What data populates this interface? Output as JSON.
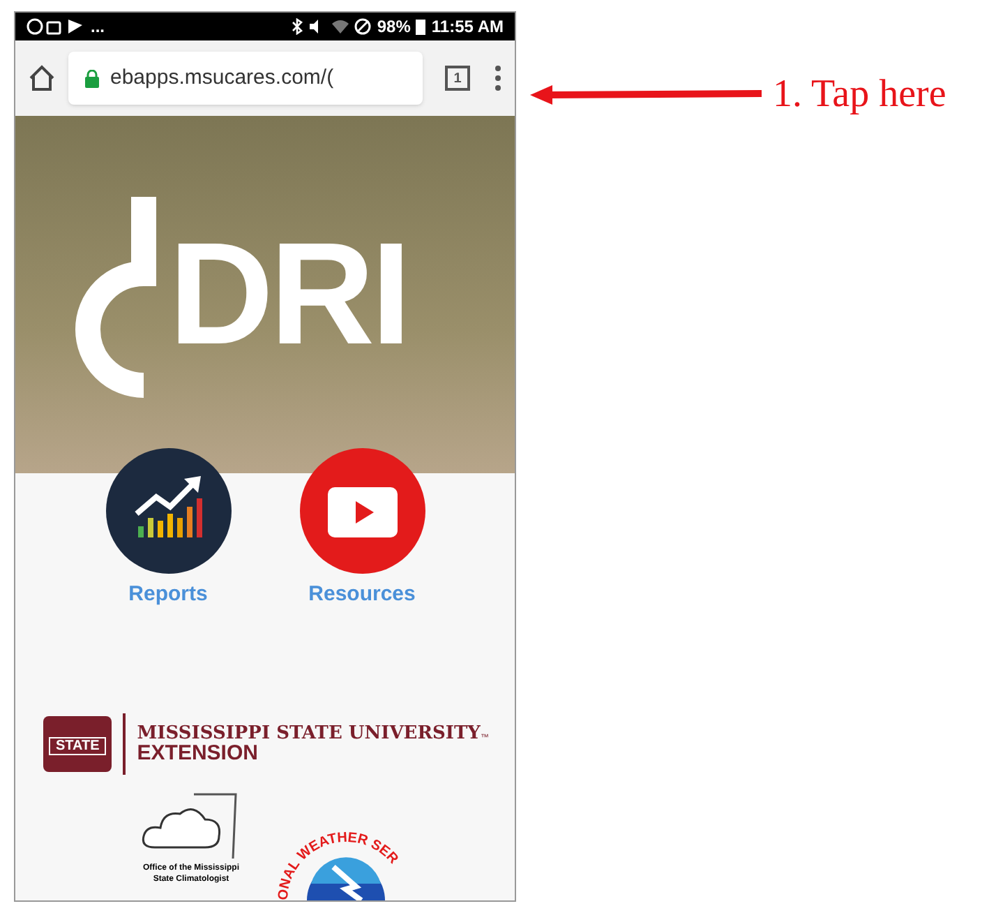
{
  "status_bar": {
    "left_more": "...",
    "battery": "98%",
    "time": "11:55 AM"
  },
  "browser": {
    "url": "ebapps.msucares.com/(",
    "tab_count": "1"
  },
  "hero": {
    "logo_text": "DRI"
  },
  "tiles": [
    {
      "kind": "chart",
      "label": "Reports"
    },
    {
      "kind": "video",
      "label": "Resources"
    }
  ],
  "footer": {
    "seal_text": "STATE",
    "university": "MISSISSIPPI STATE UNIVERSITY",
    "trademark": "™",
    "division": "EXTENSION",
    "climatologist": "Office of the Mississippi State Climatologist",
    "weather_ring": "ONAL WEATHER SER"
  },
  "annotation": {
    "text": "1. Tap here"
  }
}
